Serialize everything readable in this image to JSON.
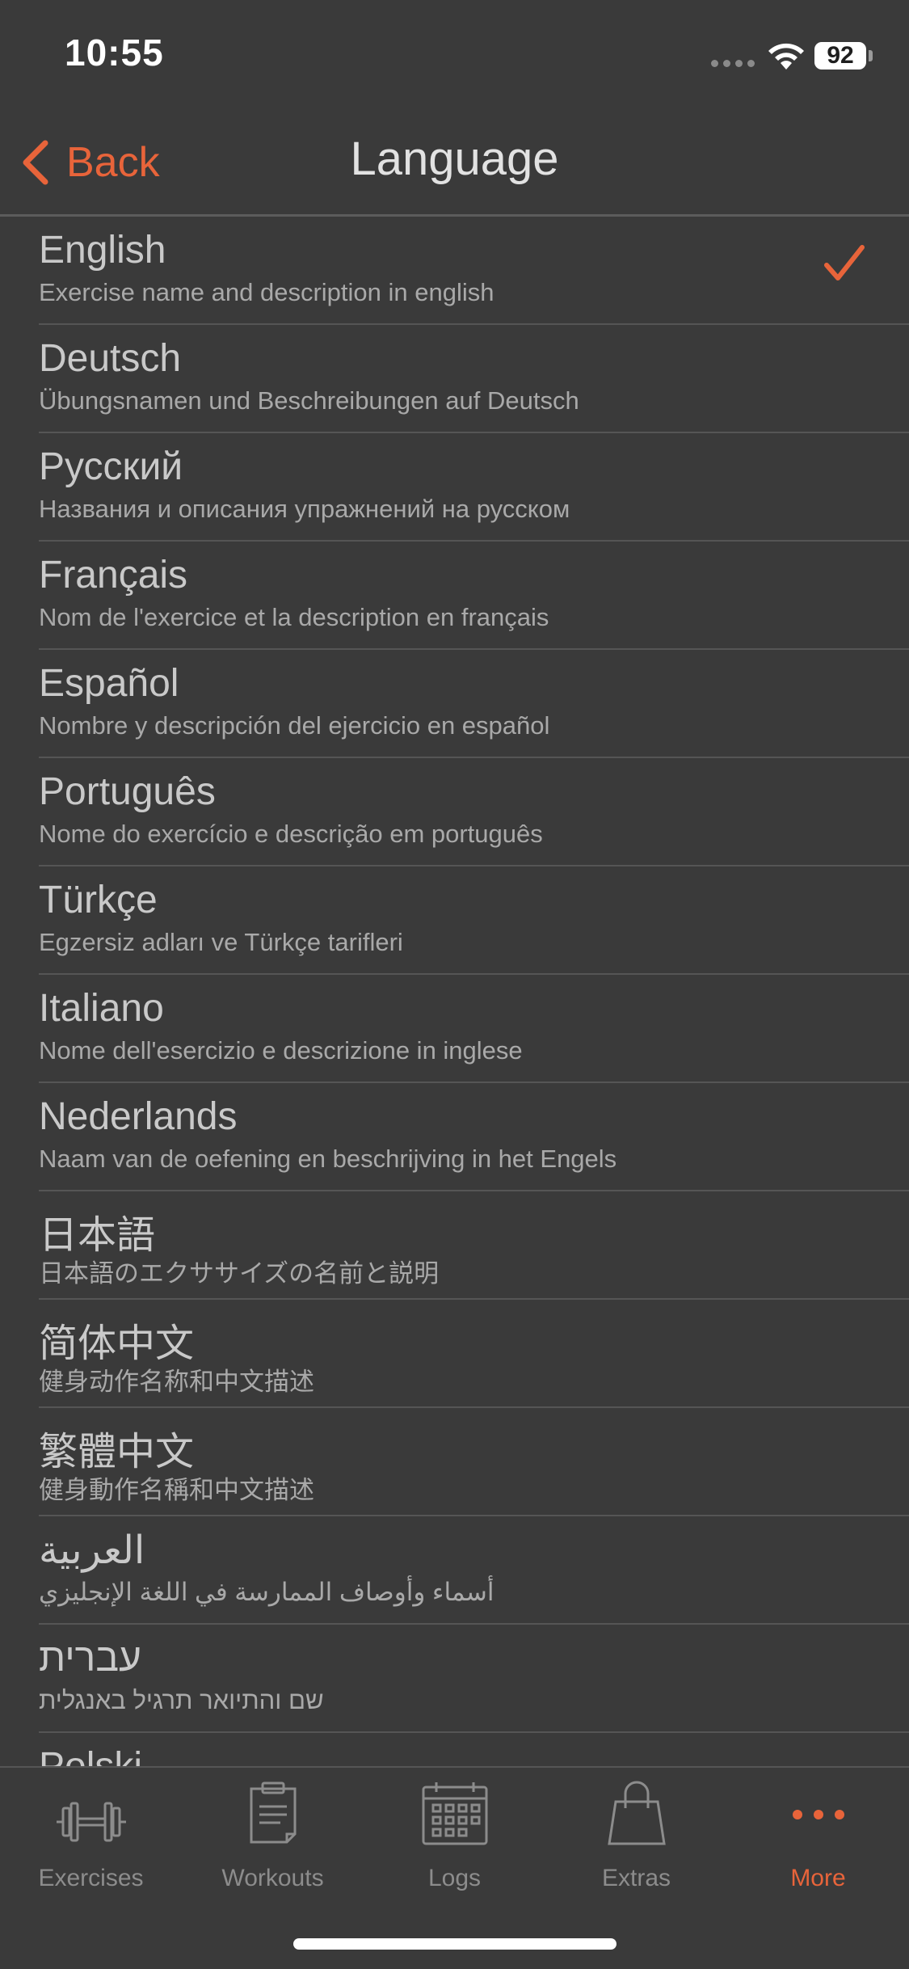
{
  "status_bar": {
    "time": "10:55",
    "battery": "92"
  },
  "nav": {
    "back_label": "Back",
    "title": "Language"
  },
  "colors": {
    "accent": "#e8643a",
    "background": "#3a3a3a",
    "text_primary": "#c9c9c9",
    "text_secondary": "#a9a9a9"
  },
  "languages": [
    {
      "name": "English",
      "desc": "Exercise name and description in english",
      "selected": true
    },
    {
      "name": "Deutsch",
      "desc": "Übungsnamen und Beschreibungen auf Deutsch",
      "selected": false
    },
    {
      "name": "Русский",
      "desc": "Названия и описания упражнений на русском",
      "selected": false
    },
    {
      "name": "Français",
      "desc": "Nom de l'exercice et la description en français",
      "selected": false
    },
    {
      "name": "Español",
      "desc": "Nombre y descripción del ejercicio en español",
      "selected": false
    },
    {
      "name": "Português",
      "desc": "Nome do exercício e descrição em português",
      "selected": false
    },
    {
      "name": "Türkçe",
      "desc": "Egzersiz adları ve Türkçe tarifleri",
      "selected": false
    },
    {
      "name": "Italiano",
      "desc": "Nome dell'esercizio e descrizione in inglese",
      "selected": false
    },
    {
      "name": "Nederlands",
      "desc": "Naam van de oefening en beschrijving in het Engels",
      "selected": false
    },
    {
      "name": "日本語",
      "desc": "日本語のエクササイズの名前と説明",
      "selected": false
    },
    {
      "name": "简体中文",
      "desc": "健身动作名称和中文描述",
      "selected": false
    },
    {
      "name": "繁體中文",
      "desc": "健身動作名稱和中文描述",
      "selected": false
    },
    {
      "name": "العربية",
      "desc": "أسماء وأوصاف الممارسة في اللغة الإنجليزي",
      "selected": false
    },
    {
      "name": "עברית",
      "desc": "שם והתיואר תרגיל באנגלית",
      "selected": false
    },
    {
      "name": "Polski",
      "desc": "",
      "selected": false
    }
  ],
  "tabs": [
    {
      "label": "Exercises",
      "icon": "dumbbell-icon",
      "active": false
    },
    {
      "label": "Workouts",
      "icon": "clipboard-icon",
      "active": false
    },
    {
      "label": "Logs",
      "icon": "calendar-icon",
      "active": false
    },
    {
      "label": "Extras",
      "icon": "shopping-bag-icon",
      "active": false
    },
    {
      "label": "More",
      "icon": "more-dots-icon",
      "active": true
    }
  ]
}
